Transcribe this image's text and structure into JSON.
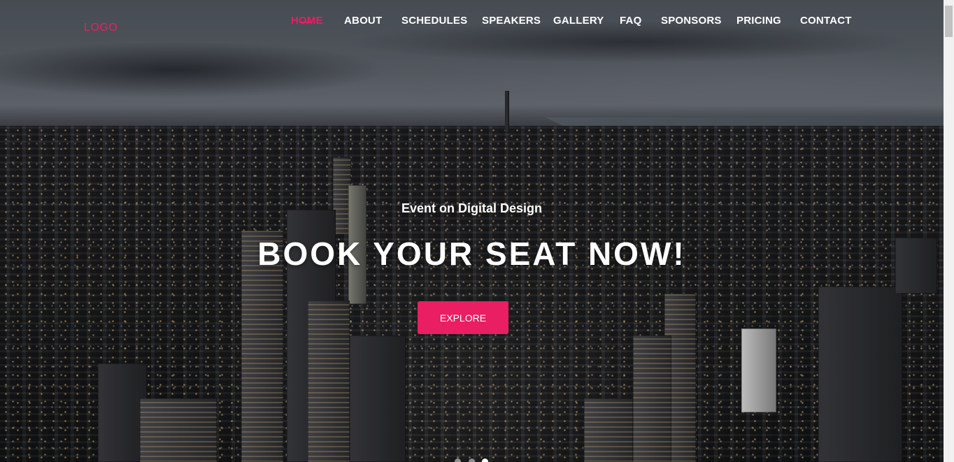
{
  "logo": "LOGO",
  "nav": {
    "items": [
      {
        "label": "HOME"
      },
      {
        "label": "ABOUT"
      },
      {
        "label": "SCHEDULES"
      },
      {
        "label": "SPEAKERS"
      },
      {
        "label": "GALLERY"
      },
      {
        "label": "FAQ"
      },
      {
        "label": "SPONSORS"
      },
      {
        "label": "PRICING"
      },
      {
        "label": "CONTACT"
      }
    ],
    "active_index": 0
  },
  "hero": {
    "subtitle": "Event on Digital Design",
    "headline": "BOOK YOUR SEAT NOW!",
    "cta_label": "EXPLORE",
    "slider": {
      "count": 3,
      "active": 2
    }
  },
  "colors": {
    "accent": "#e91e63",
    "text": "#ffffff"
  }
}
